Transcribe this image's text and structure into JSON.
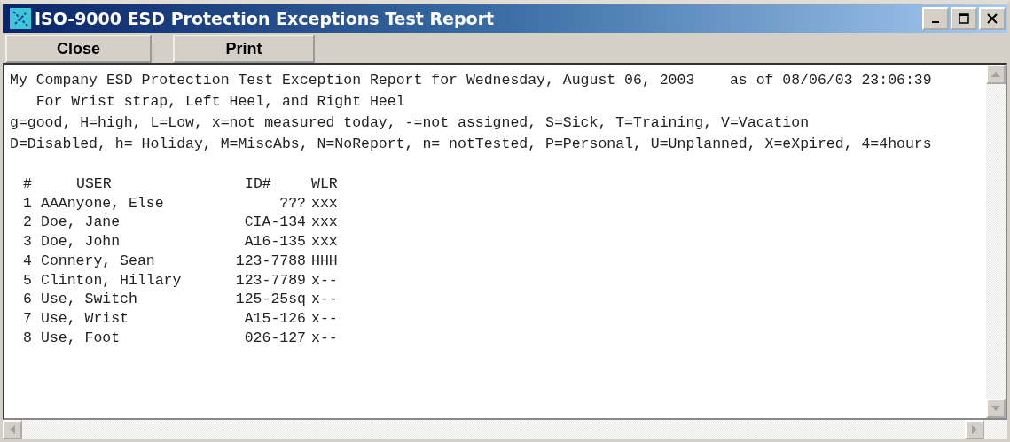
{
  "window": {
    "title": "ISO-9000 ESD Protection Exceptions Test Report"
  },
  "toolbar": {
    "buttons": [
      "Close",
      "Print"
    ]
  },
  "report": {
    "header_lines": [
      "My Company ESD Protection Test Exception Report for Wednesday, August 06, 2003    as of 08/06/03 23:06:39",
      "   For Wrist strap, Left Heel, and Right Heel",
      "g=good, H=high, L=Low, x=not measured today, -=not assigned, S=Sick, T=Training, V=Vacation",
      "D=Disabled, h= Holiday, M=MiscAbs, N=NoReport, n= notTested, P=Personal, U=Unplanned, X=eXpired, 4=4hours"
    ],
    "columns": [
      "#",
      "USER",
      "ID#",
      "WLR"
    ],
    "rows": [
      {
        "num": "1",
        "user": "AAAnyone, Else",
        "id": "???",
        "wlr": "xxx"
      },
      {
        "num": "2",
        "user": "Doe, Jane",
        "id": "CIA-134",
        "wlr": "xxx"
      },
      {
        "num": "3",
        "user": "Doe, John",
        "id": "A16-135",
        "wlr": "xxx"
      },
      {
        "num": "4",
        "user": "Connery, Sean",
        "id": "123-7788",
        "wlr": "HHH"
      },
      {
        "num": "5",
        "user": "Clinton, Hillary",
        "id": "123-7789",
        "wlr": "x--"
      },
      {
        "num": "6",
        "user": "Use, Switch",
        "id": "125-25sq",
        "wlr": "x--"
      },
      {
        "num": "7",
        "user": "Use, Wrist",
        "id": "A15-126",
        "wlr": "x--"
      },
      {
        "num": "8",
        "user": "Use, Foot",
        "id": "026-127",
        "wlr": "x--"
      }
    ]
  }
}
